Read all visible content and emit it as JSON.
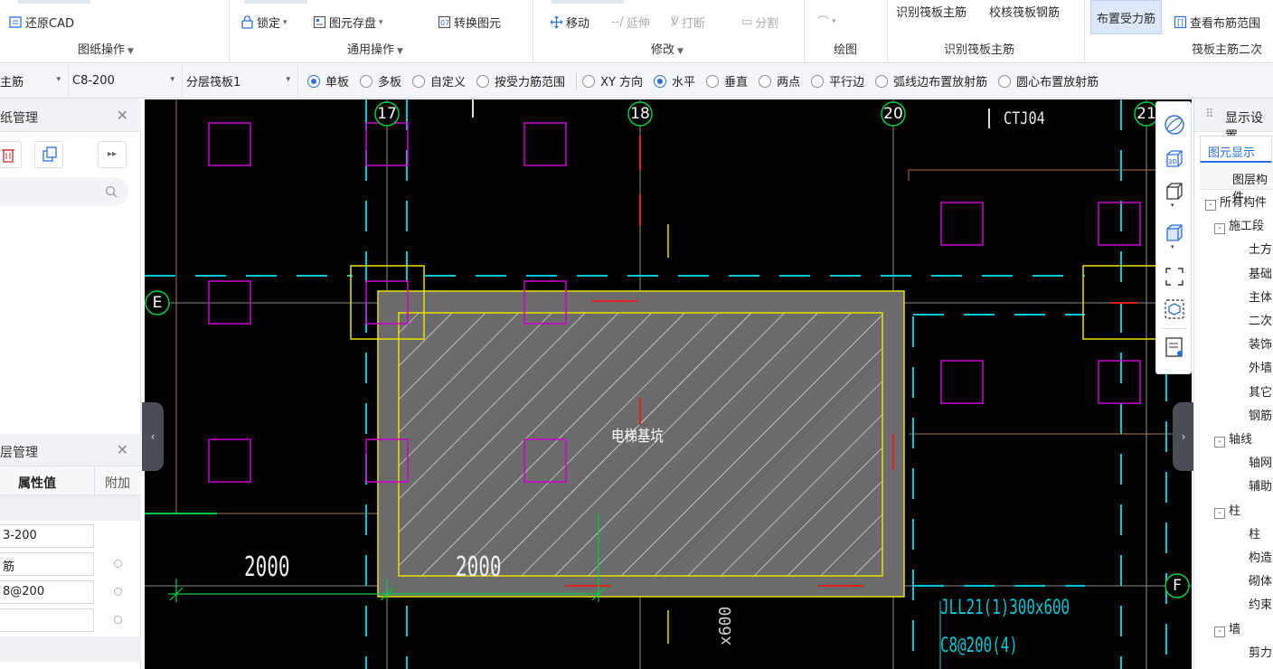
{
  "ribbon": {
    "restore_cad": "还原CAD",
    "lock": "锁定",
    "save_element": "图元存盘",
    "convert_element": "转换图元",
    "move": "移动",
    "extend": "延伸",
    "break": "打断",
    "split": "分割",
    "identify_main_rebar": "识别筏板主筋",
    "check_rebar": "校核筏板钢筋",
    "layout_stress_rebar": "布置受力筋",
    "view_rebar_range": "查看布筋范围",
    "group_titles": {
      "drawing_ops": "图纸操作",
      "general_ops": "通用操作",
      "modify": "修改",
      "draw": "绘图",
      "identify_main": "识别筏板主筋",
      "raft_secondary": "筏板主筋二次"
    }
  },
  "options": {
    "select1": "主筋",
    "select2": "C8-200",
    "select3": "分层筏板1",
    "radios": [
      {
        "label": "单板",
        "checked": true
      },
      {
        "label": "多板",
        "checked": false
      },
      {
        "label": "自定义",
        "checked": false
      },
      {
        "label": "按受力筋范围",
        "checked": false
      }
    ],
    "direction_radios": [
      {
        "label": "XY 方向",
        "checked": false
      },
      {
        "label": "水平",
        "checked": true
      },
      {
        "label": "垂直",
        "checked": false
      },
      {
        "label": "两点",
        "checked": false
      },
      {
        "label": "平行边",
        "checked": false
      },
      {
        "label": "弧线边布置放射筋",
        "checked": false
      },
      {
        "label": "圆心布置放射筋",
        "checked": false
      }
    ]
  },
  "left_panel": {
    "drawing_mgmt_title": "纸管理",
    "layer_mgmt_title": "层管理",
    "col_value": "属性值",
    "col_extra": "附加",
    "rows": [
      "3-200",
      "筋",
      "8@200",
      ""
    ]
  },
  "canvas": {
    "axes": {
      "a17": "17",
      "a18": "18",
      "a20": "20",
      "a21": "21",
      "aE": "E",
      "aF": "F"
    },
    "labels": {
      "ctj": "CTJ04",
      "pit": "电梯基坑",
      "dim1": "2000",
      "dim2": "2000",
      "beam": "JLL21(1)300x600",
      "beam_rebar": "C8@200(4)",
      "vert_dim": "x600"
    },
    "colors": {
      "bg": "#000000",
      "cyan": "#00c8d8",
      "magenta": "#d000d0",
      "yellow": "#e8e000",
      "red": "#e02020",
      "green": "#00d040",
      "grey_fill": "#6b6b6b"
    }
  },
  "view_toolbar": {
    "icons": [
      "orbit-icon",
      "3d-view-icon",
      "cube-view-icon",
      "cube-solid-icon",
      "fullscreen-icon",
      "hide-element-icon",
      "display-settings-icon"
    ]
  },
  "right_panel": {
    "title": "显示设置",
    "tab": "图元显示",
    "col_layer": "图层构件",
    "tree": [
      {
        "label": "所有构件",
        "box": "-",
        "indent": 0
      },
      {
        "label": "施工段",
        "box": "-",
        "indent": 1
      },
      {
        "label": "土方",
        "indent": 2
      },
      {
        "label": "基础",
        "indent": 2
      },
      {
        "label": "主体",
        "indent": 2
      },
      {
        "label": "二次",
        "indent": 2
      },
      {
        "label": "装饰",
        "indent": 2
      },
      {
        "label": "外墙",
        "indent": 2
      },
      {
        "label": "其它",
        "indent": 2
      },
      {
        "label": "钢筋",
        "indent": 2
      },
      {
        "label": "轴线",
        "box": "-",
        "indent": 1
      },
      {
        "label": "轴网",
        "indent": 2
      },
      {
        "label": "辅助",
        "indent": 2
      },
      {
        "label": "柱",
        "box": "-",
        "indent": 1
      },
      {
        "label": "柱",
        "indent": 2
      },
      {
        "label": "构造",
        "indent": 2
      },
      {
        "label": "砌体",
        "indent": 2
      },
      {
        "label": "约束",
        "indent": 2
      },
      {
        "label": "墙",
        "box": "-",
        "indent": 1
      },
      {
        "label": "剪力",
        "indent": 2
      }
    ]
  }
}
